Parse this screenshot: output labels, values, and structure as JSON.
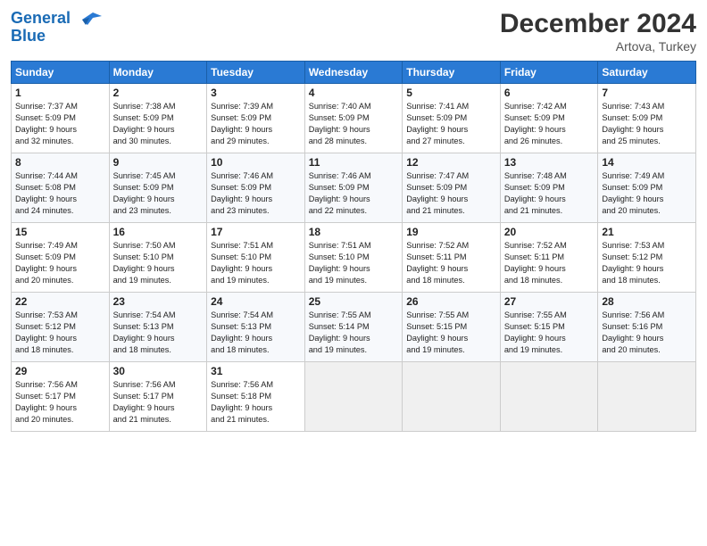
{
  "header": {
    "logo_line1": "General",
    "logo_line2": "Blue",
    "month_year": "December 2024",
    "location": "Artova, Turkey"
  },
  "days_of_week": [
    "Sunday",
    "Monday",
    "Tuesday",
    "Wednesday",
    "Thursday",
    "Friday",
    "Saturday"
  ],
  "weeks": [
    [
      {
        "day": 1,
        "sunrise": "7:37 AM",
        "sunset": "5:09 PM",
        "daylight": "9 hours and 32 minutes."
      },
      {
        "day": 2,
        "sunrise": "7:38 AM",
        "sunset": "5:09 PM",
        "daylight": "9 hours and 30 minutes."
      },
      {
        "day": 3,
        "sunrise": "7:39 AM",
        "sunset": "5:09 PM",
        "daylight": "9 hours and 29 minutes."
      },
      {
        "day": 4,
        "sunrise": "7:40 AM",
        "sunset": "5:09 PM",
        "daylight": "9 hours and 28 minutes."
      },
      {
        "day": 5,
        "sunrise": "7:41 AM",
        "sunset": "5:09 PM",
        "daylight": "9 hours and 27 minutes."
      },
      {
        "day": 6,
        "sunrise": "7:42 AM",
        "sunset": "5:09 PM",
        "daylight": "9 hours and 26 minutes."
      },
      {
        "day": 7,
        "sunrise": "7:43 AM",
        "sunset": "5:09 PM",
        "daylight": "9 hours and 25 minutes."
      }
    ],
    [
      {
        "day": 8,
        "sunrise": "7:44 AM",
        "sunset": "5:08 PM",
        "daylight": "9 hours and 24 minutes."
      },
      {
        "day": 9,
        "sunrise": "7:45 AM",
        "sunset": "5:09 PM",
        "daylight": "9 hours and 23 minutes."
      },
      {
        "day": 10,
        "sunrise": "7:46 AM",
        "sunset": "5:09 PM",
        "daylight": "9 hours and 23 minutes."
      },
      {
        "day": 11,
        "sunrise": "7:46 AM",
        "sunset": "5:09 PM",
        "daylight": "9 hours and 22 minutes."
      },
      {
        "day": 12,
        "sunrise": "7:47 AM",
        "sunset": "5:09 PM",
        "daylight": "9 hours and 21 minutes."
      },
      {
        "day": 13,
        "sunrise": "7:48 AM",
        "sunset": "5:09 PM",
        "daylight": "9 hours and 21 minutes."
      },
      {
        "day": 14,
        "sunrise": "7:49 AM",
        "sunset": "5:09 PM",
        "daylight": "9 hours and 20 minutes."
      }
    ],
    [
      {
        "day": 15,
        "sunrise": "7:49 AM",
        "sunset": "5:09 PM",
        "daylight": "9 hours and 20 minutes."
      },
      {
        "day": 16,
        "sunrise": "7:50 AM",
        "sunset": "5:10 PM",
        "daylight": "9 hours and 19 minutes."
      },
      {
        "day": 17,
        "sunrise": "7:51 AM",
        "sunset": "5:10 PM",
        "daylight": "9 hours and 19 minutes."
      },
      {
        "day": 18,
        "sunrise": "7:51 AM",
        "sunset": "5:10 PM",
        "daylight": "9 hours and 19 minutes."
      },
      {
        "day": 19,
        "sunrise": "7:52 AM",
        "sunset": "5:11 PM",
        "daylight": "9 hours and 18 minutes."
      },
      {
        "day": 20,
        "sunrise": "7:52 AM",
        "sunset": "5:11 PM",
        "daylight": "9 hours and 18 minutes."
      },
      {
        "day": 21,
        "sunrise": "7:53 AM",
        "sunset": "5:12 PM",
        "daylight": "9 hours and 18 minutes."
      }
    ],
    [
      {
        "day": 22,
        "sunrise": "7:53 AM",
        "sunset": "5:12 PM",
        "daylight": "9 hours and 18 minutes."
      },
      {
        "day": 23,
        "sunrise": "7:54 AM",
        "sunset": "5:13 PM",
        "daylight": "9 hours and 18 minutes."
      },
      {
        "day": 24,
        "sunrise": "7:54 AM",
        "sunset": "5:13 PM",
        "daylight": "9 hours and 18 minutes."
      },
      {
        "day": 25,
        "sunrise": "7:55 AM",
        "sunset": "5:14 PM",
        "daylight": "9 hours and 19 minutes."
      },
      {
        "day": 26,
        "sunrise": "7:55 AM",
        "sunset": "5:15 PM",
        "daylight": "9 hours and 19 minutes."
      },
      {
        "day": 27,
        "sunrise": "7:55 AM",
        "sunset": "5:15 PM",
        "daylight": "9 hours and 19 minutes."
      },
      {
        "day": 28,
        "sunrise": "7:56 AM",
        "sunset": "5:16 PM",
        "daylight": "9 hours and 20 minutes."
      }
    ],
    [
      {
        "day": 29,
        "sunrise": "7:56 AM",
        "sunset": "5:17 PM",
        "daylight": "9 hours and 20 minutes."
      },
      {
        "day": 30,
        "sunrise": "7:56 AM",
        "sunset": "5:17 PM",
        "daylight": "9 hours and 21 minutes."
      },
      {
        "day": 31,
        "sunrise": "7:56 AM",
        "sunset": "5:18 PM",
        "daylight": "9 hours and 21 minutes."
      },
      null,
      null,
      null,
      null
    ]
  ]
}
